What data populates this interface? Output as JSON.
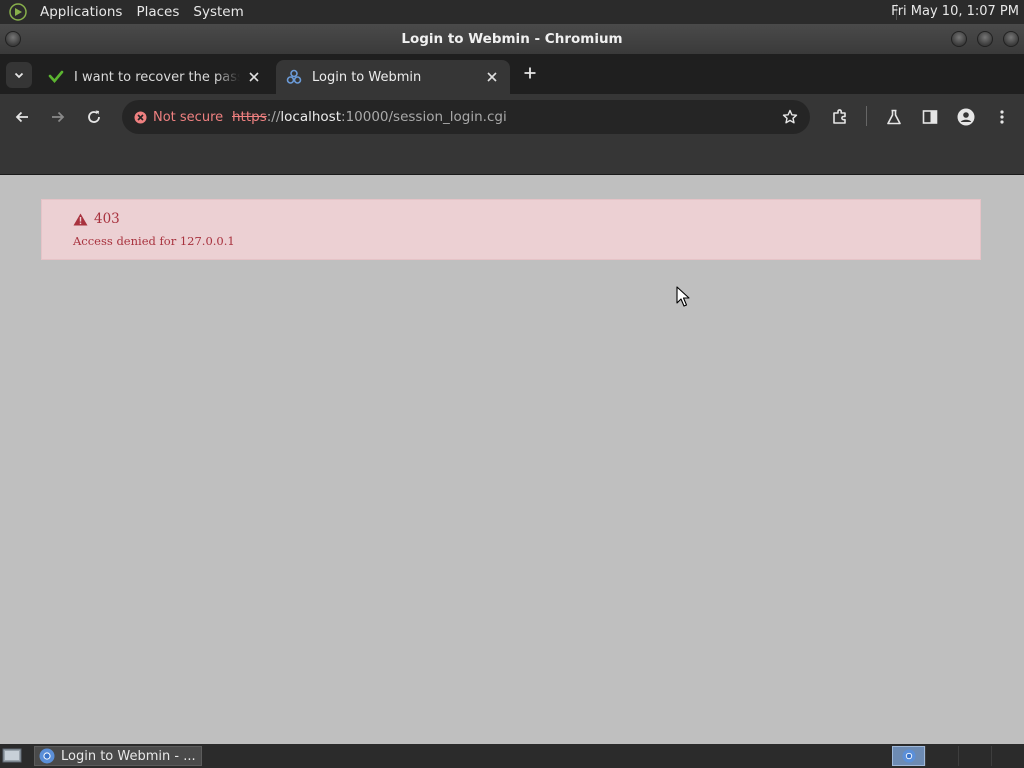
{
  "top_panel": {
    "menus": [
      "Applications",
      "Places",
      "System"
    ],
    "clock": "Fri May 10,  1:07 PM"
  },
  "window": {
    "title": "Login to Webmin - Chromium"
  },
  "tabs": [
    {
      "title": "I want to recover the password",
      "active": false
    },
    {
      "title": "Login to Webmin",
      "active": true
    }
  ],
  "omnibox": {
    "security_label": "Not secure",
    "url_scheme": "https",
    "url_sep": "://",
    "url_host": "localhost",
    "url_rest": ":10000/session_login.cgi"
  },
  "alert": {
    "code": "403",
    "message": "Access denied for 127.0.0.1"
  },
  "taskbar": {
    "task_label": "Login to Webmin - ..."
  },
  "colors": {
    "alert_bg": "#ecd0d3",
    "alert_text": "#a8323e",
    "page_bg": "#bfbfbf"
  }
}
